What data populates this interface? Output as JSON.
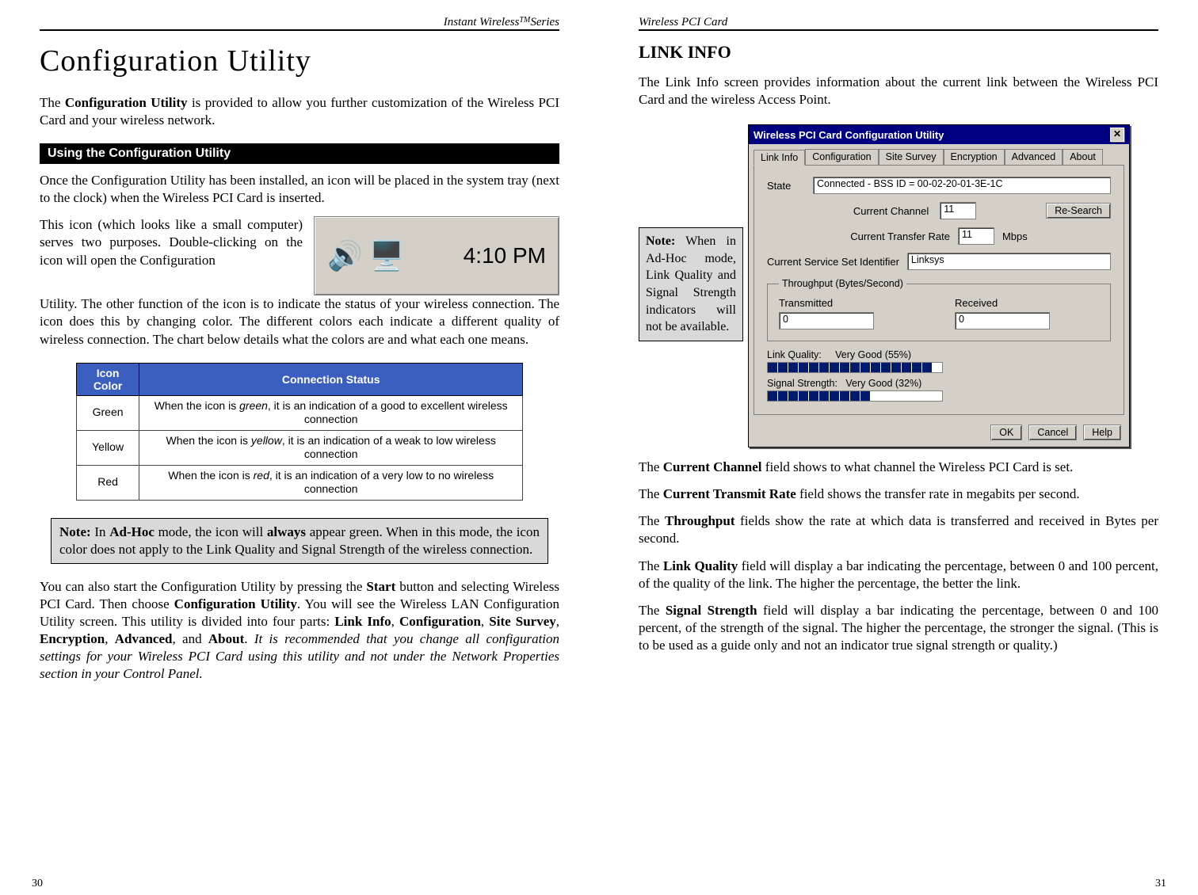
{
  "left": {
    "running_head": "Instant Wireless",
    "tm": "TM",
    "running_tail": " Series",
    "title": "Configuration Utility",
    "intro_1a": "The ",
    "intro_1b": "Configuration Utility",
    "intro_1c": " is provided to allow you further customization of the Wireless PCI Card and your wireless network.",
    "section_bar": "Using the Configuration Utility",
    "para2": "Once the Configuration Utility has been installed, an icon will be placed in the system tray (next to the clock) when the Wireless PCI Card is inserted.",
    "wrap_text": "This icon (which looks like a small computer) serves two purposes.  Double-clicking on the icon will open the Configuration",
    "para3": "Utility.  The other function of the icon is to indicate the status of your wireless connection.  The icon does this by changing color.  The different colors each indicate a different quality of wireless connection.  The chart below details what the colors are and what each one means.",
    "tray_clock": "4:10 PM",
    "table": {
      "headers": [
        "Icon Color",
        "Connection Status"
      ],
      "rows": [
        [
          "Green",
          "When the icon is green, it is an indication of a good to excellent wireless connection"
        ],
        [
          "Yellow",
          "When the icon is yellow, it is an indication of a weak to low wireless connection"
        ],
        [
          "Red",
          "When the icon is red, it is an indication of a very low to no wireless connection"
        ]
      ]
    },
    "note1_a": "Note:",
    "note1_b": "  In ",
    "note1_c": "Ad-Hoc",
    "note1_d": " mode, the icon will ",
    "note1_e": "always",
    "note1_f": " appear green.  When in this mode, the icon color does not apply to the Link Quality and Signal Strength of the wireless connection.",
    "para4_a": "You can also start the Configuration Utility by pressing the ",
    "para4_b": "Start",
    "para4_c": " button and selecting Wireless PCI Card.  Then choose ",
    "para4_d": "Configuration Utility",
    "para4_e": ".  You will see the Wireless LAN Configuration Utility screen. This utility is divided into four parts: ",
    "para4_f": "Link Info",
    "para4_g": ", ",
    "para4_h": "Configuration",
    "para4_i": ", ",
    "para4_j": "Site Survey",
    "para4_k": ", ",
    "para4_l": "Encryption",
    "para4_m": ", ",
    "para4_n": "Advanced",
    "para4_o": ", and ",
    "para4_p": "About",
    "para4_q": ".  ",
    "para4_r": "It is recommended that you change all configuration settings for your Wireless PCI Card using this utility and not under the Network Properties section in your Control Panel.",
    "page_num": "30"
  },
  "right": {
    "running_head": "Wireless PCI Card",
    "heading": "LINK INFO",
    "intro": "The Link Info screen provides information about the current link between the Wireless PCI Card and the wireless Access Point.",
    "side_note_a": "Note:",
    "side_note_b": "  When in Ad-Hoc mode, Link Quality and Signal Strength indicators will not be available.",
    "dialog": {
      "title": "Wireless PCI Card Configuration Utility",
      "tabs": [
        "Link Info",
        "Configuration",
        "Site Survey",
        "Encryption",
        "Advanced",
        "About"
      ],
      "state_label": "State",
      "state_value": "Connected - BSS ID = 00-02-20-01-3E-1C",
      "ch_label": "Current Channel",
      "ch_value": "11",
      "rescan": "Re-Search",
      "rate_label": "Current Transfer Rate",
      "rate_value": "11",
      "rate_unit": "Mbps",
      "ssid_label": "Current Service Set Identifier",
      "ssid_value": "Linksys",
      "throughput_legend": "Throughput (Bytes/Second)",
      "tx_label": "Transmitted",
      "tx_value": "0",
      "rx_label": "Received",
      "rx_value": "0",
      "lq_label": "Link Quality:",
      "lq_text": "Very Good (55%)",
      "lq_segments": 16,
      "ss_label": "Signal Strength:",
      "ss_text": "Very Good (32%)",
      "ss_segments": 10,
      "ok": "OK",
      "cancel": "Cancel",
      "help": "Help"
    },
    "p_ch_a": "The ",
    "p_ch_b": "Current Channel",
    "p_ch_c": "  field shows to what channel the Wireless PCI Card is set.",
    "p_rate_a": "The ",
    "p_rate_b": "Current Transmit  Rate",
    "p_rate_c": " field shows the transfer rate in megabits per second.",
    "p_tp_a": "The ",
    "p_tp_b": "Throughput",
    "p_tp_c": " fields show the rate at which data is transferred and received in Bytes per second.",
    "p_lq_a": "The ",
    "p_lq_b": "Link Quality",
    "p_lq_c": " field will display a bar indicating the percentage, between 0 and 100 percent, of the quality of the link.  The higher the percentage, the better the link.",
    "p_ss_a": "The ",
    "p_ss_b": "Signal Strength",
    "p_ss_c": " field will display a bar indicating the percentage, between 0 and 100 percent, of the strength of the signal.  The higher the percentage, the stronger the signal.  (This is to be used as a guide only and not an indicator true signal strength or quality.)",
    "page_num": "31"
  }
}
